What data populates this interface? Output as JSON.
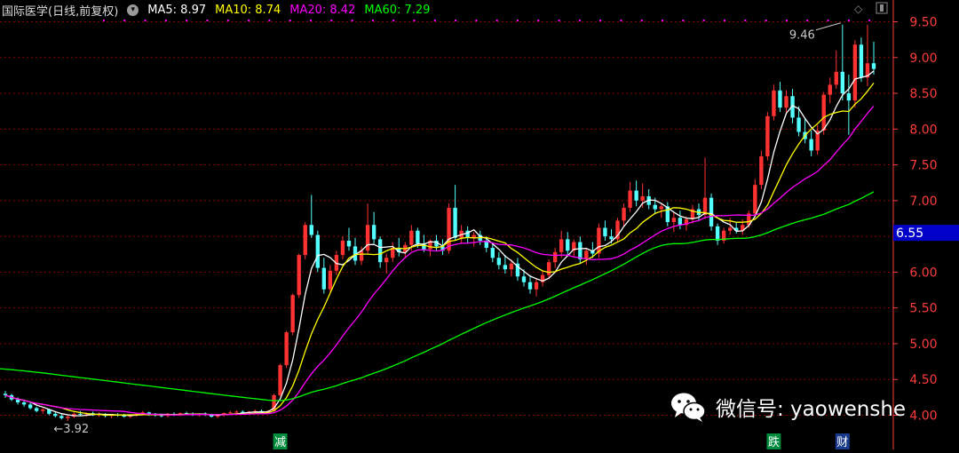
{
  "header": {
    "title": "国际医学(日线,前复权)",
    "ma5_label": "MA5: 8.97",
    "ma10_label": "MA10: 8.74",
    "ma20_label": "MA20: 8.42",
    "ma60_label": "MA60: 7.29",
    "dropdown_glyph": "▾"
  },
  "colors": {
    "background": "#000000",
    "up": "#ff3232",
    "down": "#54ffff",
    "ma5": "#ffffff",
    "ma10": "#ffff00",
    "ma20": "#ff00ff",
    "ma60": "#00ff00",
    "grid": "#8b0000",
    "axis_text": "#ff3c3c",
    "current_price_bg": "#0000c8"
  },
  "markers": {
    "high_label": "9.46",
    "low_label": "3.92",
    "current_price": "6.55"
  },
  "event_tags": [
    "减",
    "跌",
    "财"
  ],
  "watermark": {
    "text": "微信号: yaowenshe",
    "icon": "wechat-icon"
  },
  "chart_data": {
    "type": "candlestick",
    "title": "国际医学(日线,前复权)",
    "y_ticks": [
      4.0,
      4.5,
      5.0,
      5.5,
      6.0,
      6.5,
      7.0,
      7.5,
      8.0,
      8.5,
      9.0,
      9.5
    ],
    "ylim": [
      3.82,
      9.68
    ],
    "grid": true,
    "y_axis_position": "right",
    "candles_ohlc": [
      [
        4.3,
        4.34,
        4.24,
        4.28
      ],
      [
        4.28,
        4.3,
        4.2,
        4.22
      ],
      [
        4.22,
        4.25,
        4.15,
        4.18
      ],
      [
        4.18,
        4.22,
        4.12,
        4.15
      ],
      [
        4.15,
        4.18,
        4.08,
        4.1
      ],
      [
        4.1,
        4.12,
        4.04,
        4.06
      ],
      [
        4.06,
        4.1,
        4.02,
        4.08
      ],
      [
        4.08,
        4.09,
        4.0,
        4.02
      ],
      [
        4.02,
        4.05,
        3.97,
        3.99
      ],
      [
        3.99,
        4.02,
        3.94,
        3.96
      ],
      [
        3.96,
        4.0,
        3.92,
        3.98
      ],
      [
        3.98,
        4.04,
        3.96,
        4.02
      ],
      [
        4.02,
        4.06,
        3.99,
        4.01
      ],
      [
        4.01,
        4.04,
        3.98,
        4.03
      ],
      [
        4.03,
        4.05,
        3.99,
        4.0
      ],
      [
        4.0,
        4.04,
        3.98,
        4.02
      ],
      [
        4.02,
        4.03,
        3.97,
        3.99
      ],
      [
        3.99,
        4.02,
        3.96,
        4.01
      ],
      [
        4.01,
        4.03,
        3.98,
        4.0
      ],
      [
        4.0,
        4.02,
        3.97,
        3.98
      ],
      [
        3.98,
        4.01,
        3.96,
        4.0
      ],
      [
        4.0,
        4.03,
        3.98,
        4.02
      ],
      [
        4.02,
        4.06,
        4.0,
        4.04
      ],
      [
        4.04,
        4.05,
        3.99,
        4.01
      ],
      [
        4.01,
        4.03,
        3.98,
        4.0
      ],
      [
        4.0,
        4.02,
        3.97,
        3.99
      ],
      [
        3.99,
        4.03,
        3.97,
        4.02
      ],
      [
        4.02,
        4.04,
        3.99,
        4.01
      ],
      [
        4.01,
        4.04,
        3.99,
        4.03
      ],
      [
        4.03,
        4.05,
        4.0,
        4.02
      ],
      [
        4.02,
        4.04,
        3.99,
        4.0
      ],
      [
        4.0,
        4.03,
        3.98,
        4.02
      ],
      [
        4.02,
        4.04,
        3.99,
        4.01
      ],
      [
        4.01,
        4.02,
        3.97,
        3.98
      ],
      [
        3.98,
        4.01,
        3.96,
        4.0
      ],
      [
        4.0,
        4.04,
        3.98,
        4.03
      ],
      [
        4.03,
        4.06,
        4.01,
        4.04
      ],
      [
        4.04,
        4.07,
        4.02,
        4.05
      ],
      [
        4.05,
        4.07,
        4.02,
        4.03
      ],
      [
        4.03,
        4.06,
        4.01,
        4.05
      ],
      [
        4.05,
        4.08,
        4.03,
        4.06
      ],
      [
        4.06,
        4.08,
        4.03,
        4.04
      ],
      [
        4.04,
        4.07,
        4.02,
        4.06
      ],
      [
        4.06,
        4.3,
        4.05,
        4.28
      ],
      [
        4.28,
        4.72,
        4.26,
        4.7
      ],
      [
        4.7,
        5.18,
        4.66,
        5.16
      ],
      [
        5.16,
        5.7,
        5.12,
        5.68
      ],
      [
        5.68,
        6.26,
        5.64,
        6.24
      ],
      [
        6.24,
        6.7,
        6.18,
        6.66
      ],
      [
        6.66,
        7.08,
        6.48,
        6.52
      ],
      [
        6.52,
        6.58,
        6.0,
        6.06
      ],
      [
        6.06,
        6.2,
        5.7,
        5.76
      ],
      [
        5.76,
        6.1,
        5.72,
        6.02
      ],
      [
        6.02,
        6.3,
        5.96,
        6.24
      ],
      [
        6.24,
        6.5,
        6.18,
        6.44
      ],
      [
        6.44,
        6.62,
        6.3,
        6.36
      ],
      [
        6.36,
        6.48,
        6.1,
        6.16
      ],
      [
        6.16,
        6.36,
        6.1,
        6.3
      ],
      [
        6.3,
        6.96,
        6.26,
        6.66
      ],
      [
        6.66,
        6.84,
        6.4,
        6.46
      ],
      [
        6.46,
        6.5,
        6.06,
        6.14
      ],
      [
        6.14,
        6.26,
        5.98,
        6.2
      ],
      [
        6.2,
        6.42,
        6.14,
        6.34
      ],
      [
        6.34,
        6.48,
        6.22,
        6.28
      ],
      [
        6.28,
        6.42,
        6.2,
        6.38
      ],
      [
        6.38,
        6.66,
        6.3,
        6.58
      ],
      [
        6.58,
        6.62,
        6.34,
        6.4
      ],
      [
        6.4,
        6.52,
        6.28,
        6.32
      ],
      [
        6.32,
        6.46,
        6.22,
        6.44
      ],
      [
        6.44,
        6.52,
        6.3,
        6.36
      ],
      [
        6.36,
        6.46,
        6.24,
        6.3
      ],
      [
        6.3,
        6.96,
        6.26,
        6.9
      ],
      [
        6.9,
        7.22,
        6.44,
        6.48
      ],
      [
        6.48,
        6.66,
        6.4,
        6.58
      ],
      [
        6.58,
        6.64,
        6.4,
        6.48
      ],
      [
        6.48,
        6.56,
        6.36,
        6.52
      ],
      [
        6.52,
        6.58,
        6.38,
        6.44
      ],
      [
        6.44,
        6.5,
        6.28,
        6.34
      ],
      [
        6.34,
        6.42,
        6.14,
        6.2
      ],
      [
        6.2,
        6.28,
        6.04,
        6.1
      ],
      [
        6.1,
        6.24,
        5.98,
        6.04
      ],
      [
        6.04,
        6.18,
        5.94,
        6.12
      ],
      [
        6.12,
        6.2,
        5.88,
        5.94
      ],
      [
        5.94,
        6.04,
        5.8,
        5.86
      ],
      [
        5.86,
        5.96,
        5.7,
        5.76
      ],
      [
        5.76,
        5.92,
        5.66,
        5.86
      ],
      [
        5.86,
        6.02,
        5.8,
        5.96
      ],
      [
        5.96,
        6.18,
        5.9,
        6.14
      ],
      [
        6.14,
        6.34,
        6.06,
        6.28
      ],
      [
        6.28,
        6.58,
        6.2,
        6.46
      ],
      [
        6.46,
        6.56,
        6.24,
        6.3
      ],
      [
        6.3,
        6.46,
        6.22,
        6.42
      ],
      [
        6.42,
        6.5,
        6.12,
        6.18
      ],
      [
        6.18,
        6.34,
        6.1,
        6.3
      ],
      [
        6.3,
        6.42,
        6.2,
        6.26
      ],
      [
        6.26,
        6.68,
        6.2,
        6.62
      ],
      [
        6.62,
        6.72,
        6.44,
        6.5
      ],
      [
        6.5,
        6.6,
        6.4,
        6.46
      ],
      [
        6.46,
        6.76,
        6.42,
        6.72
      ],
      [
        6.72,
        6.96,
        6.64,
        6.9
      ],
      [
        6.9,
        7.26,
        6.84,
        7.14
      ],
      [
        7.14,
        7.28,
        6.92,
        7.0
      ],
      [
        7.0,
        7.24,
        6.9,
        7.06
      ],
      [
        7.06,
        7.16,
        6.88,
        6.94
      ],
      [
        6.94,
        7.04,
        6.82,
        6.88
      ],
      [
        6.88,
        6.96,
        6.76,
        6.92
      ],
      [
        6.92,
        6.98,
        6.64,
        6.7
      ],
      [
        6.7,
        6.84,
        6.56,
        6.76
      ],
      [
        6.76,
        6.86,
        6.6,
        6.66
      ],
      [
        6.66,
        6.78,
        6.58,
        6.74
      ],
      [
        6.74,
        6.94,
        6.68,
        6.88
      ],
      [
        6.88,
        6.96,
        6.72,
        6.8
      ],
      [
        6.8,
        7.6,
        6.74,
        7.04
      ],
      [
        7.04,
        7.1,
        6.58,
        6.64
      ],
      [
        6.64,
        6.68,
        6.38,
        6.44
      ],
      [
        6.44,
        6.62,
        6.4,
        6.58
      ],
      [
        6.58,
        6.76,
        6.52,
        6.62
      ],
      [
        6.62,
        6.7,
        6.54,
        6.58
      ],
      [
        6.58,
        6.74,
        6.52,
        6.66
      ],
      [
        6.66,
        6.86,
        6.62,
        6.82
      ],
      [
        6.82,
        7.3,
        6.78,
        7.22
      ],
      [
        7.22,
        7.7,
        7.16,
        7.62
      ],
      [
        7.62,
        8.24,
        7.56,
        8.18
      ],
      [
        8.18,
        8.62,
        8.12,
        8.54
      ],
      [
        8.54,
        8.66,
        8.24,
        8.3
      ],
      [
        8.3,
        8.54,
        8.2,
        8.46
      ],
      [
        8.46,
        8.56,
        8.08,
        8.16
      ],
      [
        8.16,
        8.32,
        7.9,
        7.96
      ],
      [
        7.96,
        8.16,
        7.8,
        7.86
      ],
      [
        7.86,
        7.98,
        7.62,
        7.7
      ],
      [
        7.7,
        8.06,
        7.64,
        7.98
      ],
      [
        7.98,
        8.52,
        7.92,
        8.48
      ],
      [
        8.48,
        8.72,
        8.36,
        8.62
      ],
      [
        8.62,
        9.1,
        8.56,
        8.8
      ],
      [
        8.8,
        9.46,
        8.4,
        8.5
      ],
      [
        8.5,
        8.76,
        7.92,
        8.4
      ],
      [
        8.4,
        9.24,
        8.3,
        9.18
      ],
      [
        9.18,
        9.28,
        8.66,
        8.72
      ],
      [
        8.72,
        9.46,
        8.6,
        8.92
      ],
      [
        8.92,
        9.22,
        8.76,
        8.84
      ]
    ],
    "ma_params": [
      5,
      10,
      20,
      60
    ],
    "ma60_start": 4.65,
    "series_names": [
      "MA5",
      "MA10",
      "MA20",
      "MA60"
    ]
  }
}
